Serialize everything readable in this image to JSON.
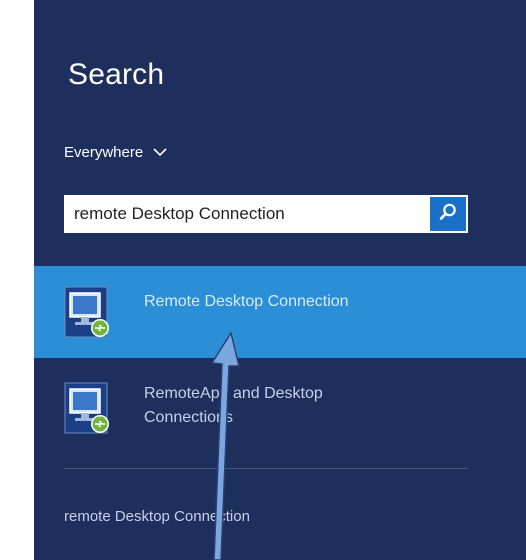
{
  "search_pane": {
    "title": "Search",
    "scope_label": "Everywhere",
    "query_value": "remote Desktop Connection"
  },
  "results": [
    {
      "label": "Remote Desktop Connection",
      "selected": true
    },
    {
      "label": "RemoteApp and Desktop Connections",
      "selected": false
    }
  ],
  "suggestions": [
    {
      "label": "remote Desktop Connection"
    }
  ],
  "icons": {
    "scope_chevron": "chevron-down-icon",
    "search": "search-icon",
    "app": "remote-desktop-app-icon"
  },
  "colors": {
    "pane_background": "#1e2f5d",
    "selected_result": "#2b8fd8",
    "search_button": "#1a6fc8",
    "annotation_arrow": "#7ba6e0"
  }
}
